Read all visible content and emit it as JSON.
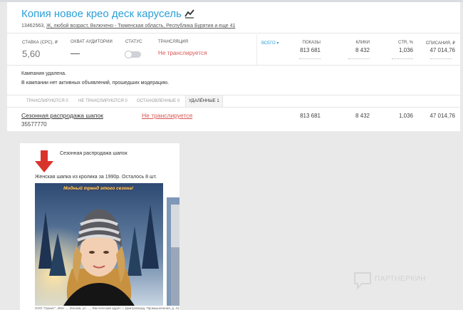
{
  "header": {
    "title": "Копия новое крео деск карусель",
    "subtitle_id": "13462563,",
    "subtitle_targeting": "Ж, любой возраст, Включено - Тюменская область, Республика Бурятия и еще 41"
  },
  "stats": {
    "bid_label": "СТАВКА (CPC), ₽",
    "bid_value": "5,60",
    "reach_label": "ОХВАТ АУДИТОРИИ",
    "reach_value": "—",
    "status_label": "СТАТУС",
    "broadcast_label": "ТРАНСЛЯЦИЯ",
    "broadcast_value": "Не транслируется",
    "all_button": "ВСЕГО ▾",
    "columns": [
      {
        "label": "ПОКАЗЫ",
        "value": "813 681"
      },
      {
        "label": "КЛИКИ",
        "value": "8 432"
      },
      {
        "label": "CTR, %",
        "value": "1,036"
      },
      {
        "label": "СПИСАНИЯ, ₽",
        "value": "47 014,76"
      }
    ]
  },
  "notice": {
    "line1": "Кампания удалена.",
    "line2": "В кампании нет активных объявлений, прошедших модерацию."
  },
  "tabs": [
    {
      "label": "ТРАНСЛИРУЮТСЯ 0"
    },
    {
      "label": "НЕ ТРАНСЛИРУЮТСЯ 0"
    },
    {
      "label": "ОСТАНОВЛЕННЫЕ 0"
    },
    {
      "label": "УДАЛЁННЫЕ 1"
    }
  ],
  "ad_row": {
    "name": "Сезонная распродажа шапок",
    "id": "35577770",
    "status": "Не транслируется",
    "impressions": "813 681",
    "clicks": "8 432",
    "ctr": "1,036",
    "spend": "47 014,76"
  },
  "ad_preview": {
    "title": "Сезонная распродажа шапок",
    "text": "Женская шапка из кролика за 1990р. Осталось 8 шт.",
    "image_caption": "Модный тренд этого сезона!",
    "footer": "ООО \"Гранит\", ИНН ..., Москва, ул. ..., Фактический адрес: г. Дмитровград, Промышленная, д. 41",
    "footer2": "ООО \"Гр"
  },
  "watermark": {
    "text": "ПАРТНЕРКИН"
  },
  "colors": {
    "accent": "#2a9fd8",
    "danger": "#d9534f",
    "background": "#e9e9ea"
  },
  "icons": [
    "chart-line-icon",
    "arrow-down-icon",
    "chat-bubble-icon"
  ]
}
